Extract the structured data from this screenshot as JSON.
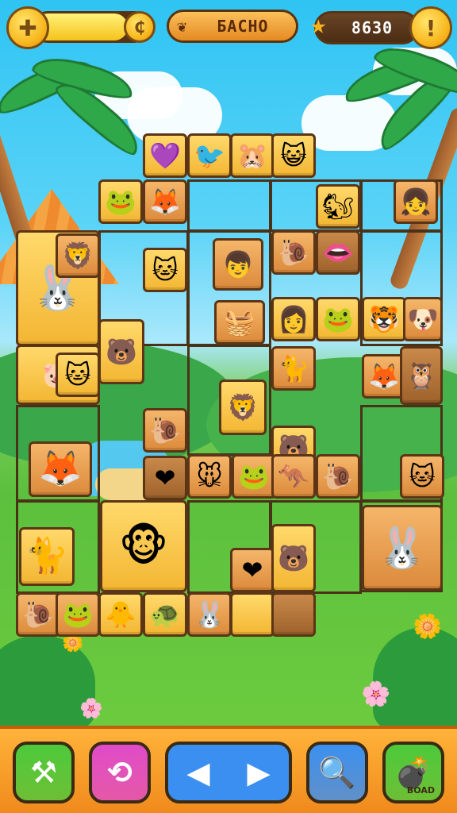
{
  "hud": {
    "left_icon": "puzzle-piece-icon",
    "progress_fraction": 0.82,
    "progress_end_icon": "coin-icon",
    "title_icon": "leaf-icon",
    "title": "БАСНО",
    "star_icon": "star-icon",
    "score": "8630",
    "alert_icon": "exclamation-icon",
    "alert_symbol": "!"
  },
  "board": {
    "tiles": [
      {
        "name": "heart-tile",
        "glyph": "💜"
      },
      {
        "name": "bird-tile",
        "glyph": "🐦"
      },
      {
        "name": "hamster-tile",
        "glyph": "🐹"
      },
      {
        "name": "cat-face-tile",
        "glyph": "😺"
      },
      {
        "name": "frog-tile",
        "glyph": "🐸"
      },
      {
        "name": "fox-tile",
        "glyph": "🦊"
      },
      {
        "name": "squirrel-tile",
        "glyph": "🐿"
      },
      {
        "name": "girl-face-tile",
        "glyph": "👧"
      },
      {
        "name": "bunny-girl-tile",
        "glyph": "🐰"
      },
      {
        "name": "lion-tile",
        "glyph": "🦁"
      },
      {
        "name": "gray-cat-tile",
        "glyph": "🐱"
      },
      {
        "name": "boy-face-tile",
        "glyph": "👦"
      },
      {
        "name": "snail-tile",
        "glyph": "🐌"
      },
      {
        "name": "lips-tile",
        "glyph": "👄"
      },
      {
        "name": "bear-tile",
        "glyph": "🐻"
      },
      {
        "name": "basket-tile",
        "glyph": "🧺"
      },
      {
        "name": "girl-curly-tile",
        "glyph": "👩"
      },
      {
        "name": "frog-2-tile",
        "glyph": "🐸"
      },
      {
        "name": "tiger-tile",
        "glyph": "🐯"
      },
      {
        "name": "dog-tile",
        "glyph": "🐶"
      },
      {
        "name": "pig-tile",
        "glyph": "🐷"
      },
      {
        "name": "cat-2-tile",
        "glyph": "🐱"
      },
      {
        "name": "orange-cat-tile",
        "glyph": "🐈"
      },
      {
        "name": "fox-2-tile",
        "glyph": "🦊"
      },
      {
        "name": "owl-tile",
        "glyph": "🦉"
      },
      {
        "name": "lion-2-tile",
        "glyph": "🦁"
      },
      {
        "name": "snail-2-tile",
        "glyph": "🐌"
      },
      {
        "name": "fox-girl-tile",
        "glyph": "🦊"
      },
      {
        "name": "bear-2-tile",
        "glyph": "🐻"
      },
      {
        "name": "heart-2-tile",
        "glyph": "❤"
      },
      {
        "name": "mouse-tile",
        "glyph": "🐭"
      },
      {
        "name": "frog-3-tile",
        "glyph": "🐸"
      },
      {
        "name": "kangaroo-tile",
        "glyph": "🦘"
      },
      {
        "name": "snail-3-tile",
        "glyph": "🐌"
      },
      {
        "name": "purple-cat-tile",
        "glyph": "🐱"
      },
      {
        "name": "monkey-girl-tile",
        "glyph": "🐵"
      },
      {
        "name": "heart-3-tile",
        "glyph": "❤"
      },
      {
        "name": "bear-3-tile",
        "glyph": "🐻"
      },
      {
        "name": "bunny-tile",
        "glyph": "🐰"
      },
      {
        "name": "black-cat-tile",
        "glyph": "🐈"
      },
      {
        "name": "snail-4-tile",
        "glyph": "🐌"
      },
      {
        "name": "frog-4-tile",
        "glyph": "🐸"
      },
      {
        "name": "chick-tile",
        "glyph": "🐥"
      },
      {
        "name": "turtle-tile",
        "glyph": "🐢"
      },
      {
        "name": "purple-bunny-tile",
        "glyph": "🐰"
      }
    ]
  },
  "toolbar": {
    "buttons": [
      {
        "name": "hammer-button",
        "icon": "hammer-icon",
        "glyph": "⚒",
        "color": "#4cc93a"
      },
      {
        "name": "shuffle-button",
        "icon": "shuffle-icon",
        "glyph": "⟲",
        "color": "#e04ac8"
      },
      {
        "name": "prev-button",
        "icon": "arrow-left-icon",
        "glyph": "◀",
        "color": "#3b8ff0"
      },
      {
        "name": "next-button",
        "icon": "arrow-right-icon",
        "glyph": "▶",
        "color": "#3b8ff0"
      },
      {
        "name": "hint-button",
        "icon": "magnifier-icon",
        "glyph": "🔍",
        "color": "#3b8ff0"
      },
      {
        "name": "board-button",
        "icon": "bomb-icon",
        "glyph": "💣",
        "color": "#4cc93a",
        "label": "BOAD"
      }
    ]
  }
}
